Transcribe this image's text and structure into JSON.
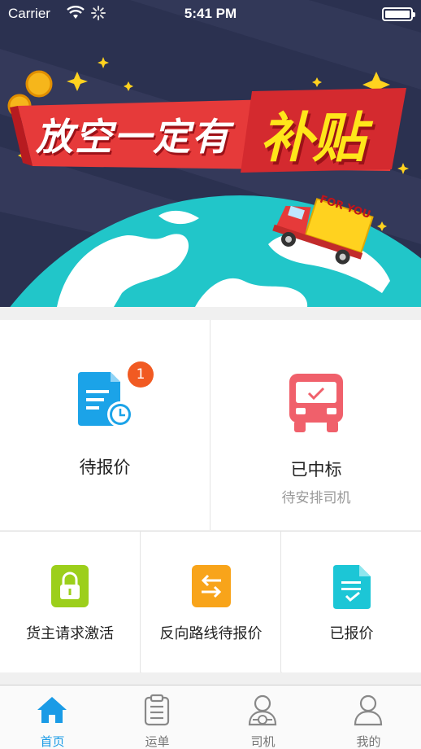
{
  "status_bar": {
    "carrier": "Carrier",
    "time": "5:41 PM"
  },
  "banner": {
    "headline_part1": "放空一定有",
    "headline_part2": "补贴",
    "truck_sign": "FOR YOU"
  },
  "features": {
    "pending_quote": {
      "label": "待报价",
      "badge": "1"
    },
    "won_bid": {
      "label": "已中标",
      "sublabel": "待安排司机"
    },
    "shipper_activation": {
      "label": "货主请求激活"
    },
    "return_route": {
      "label": "反向路线待报价"
    },
    "quoted": {
      "label": "已报价"
    }
  },
  "tabbar": {
    "tabs": [
      {
        "label": "首页",
        "icon": "home-icon",
        "active": true
      },
      {
        "label": "运单",
        "icon": "clipboard-icon",
        "active": false
      },
      {
        "label": "司机",
        "icon": "driver-icon",
        "active": false
      },
      {
        "label": "我的",
        "icon": "person-icon",
        "active": false
      }
    ]
  },
  "colors": {
    "accent": "#1a9be6",
    "badge": "#f15a22",
    "banner_bg": "#2b3150",
    "quote_icon": "#1ba3e8",
    "won_icon": "#f0606b",
    "activation_icon": "#9ccf1b",
    "return_icon": "#f8a41a",
    "quoted_icon": "#1cc6d6"
  }
}
